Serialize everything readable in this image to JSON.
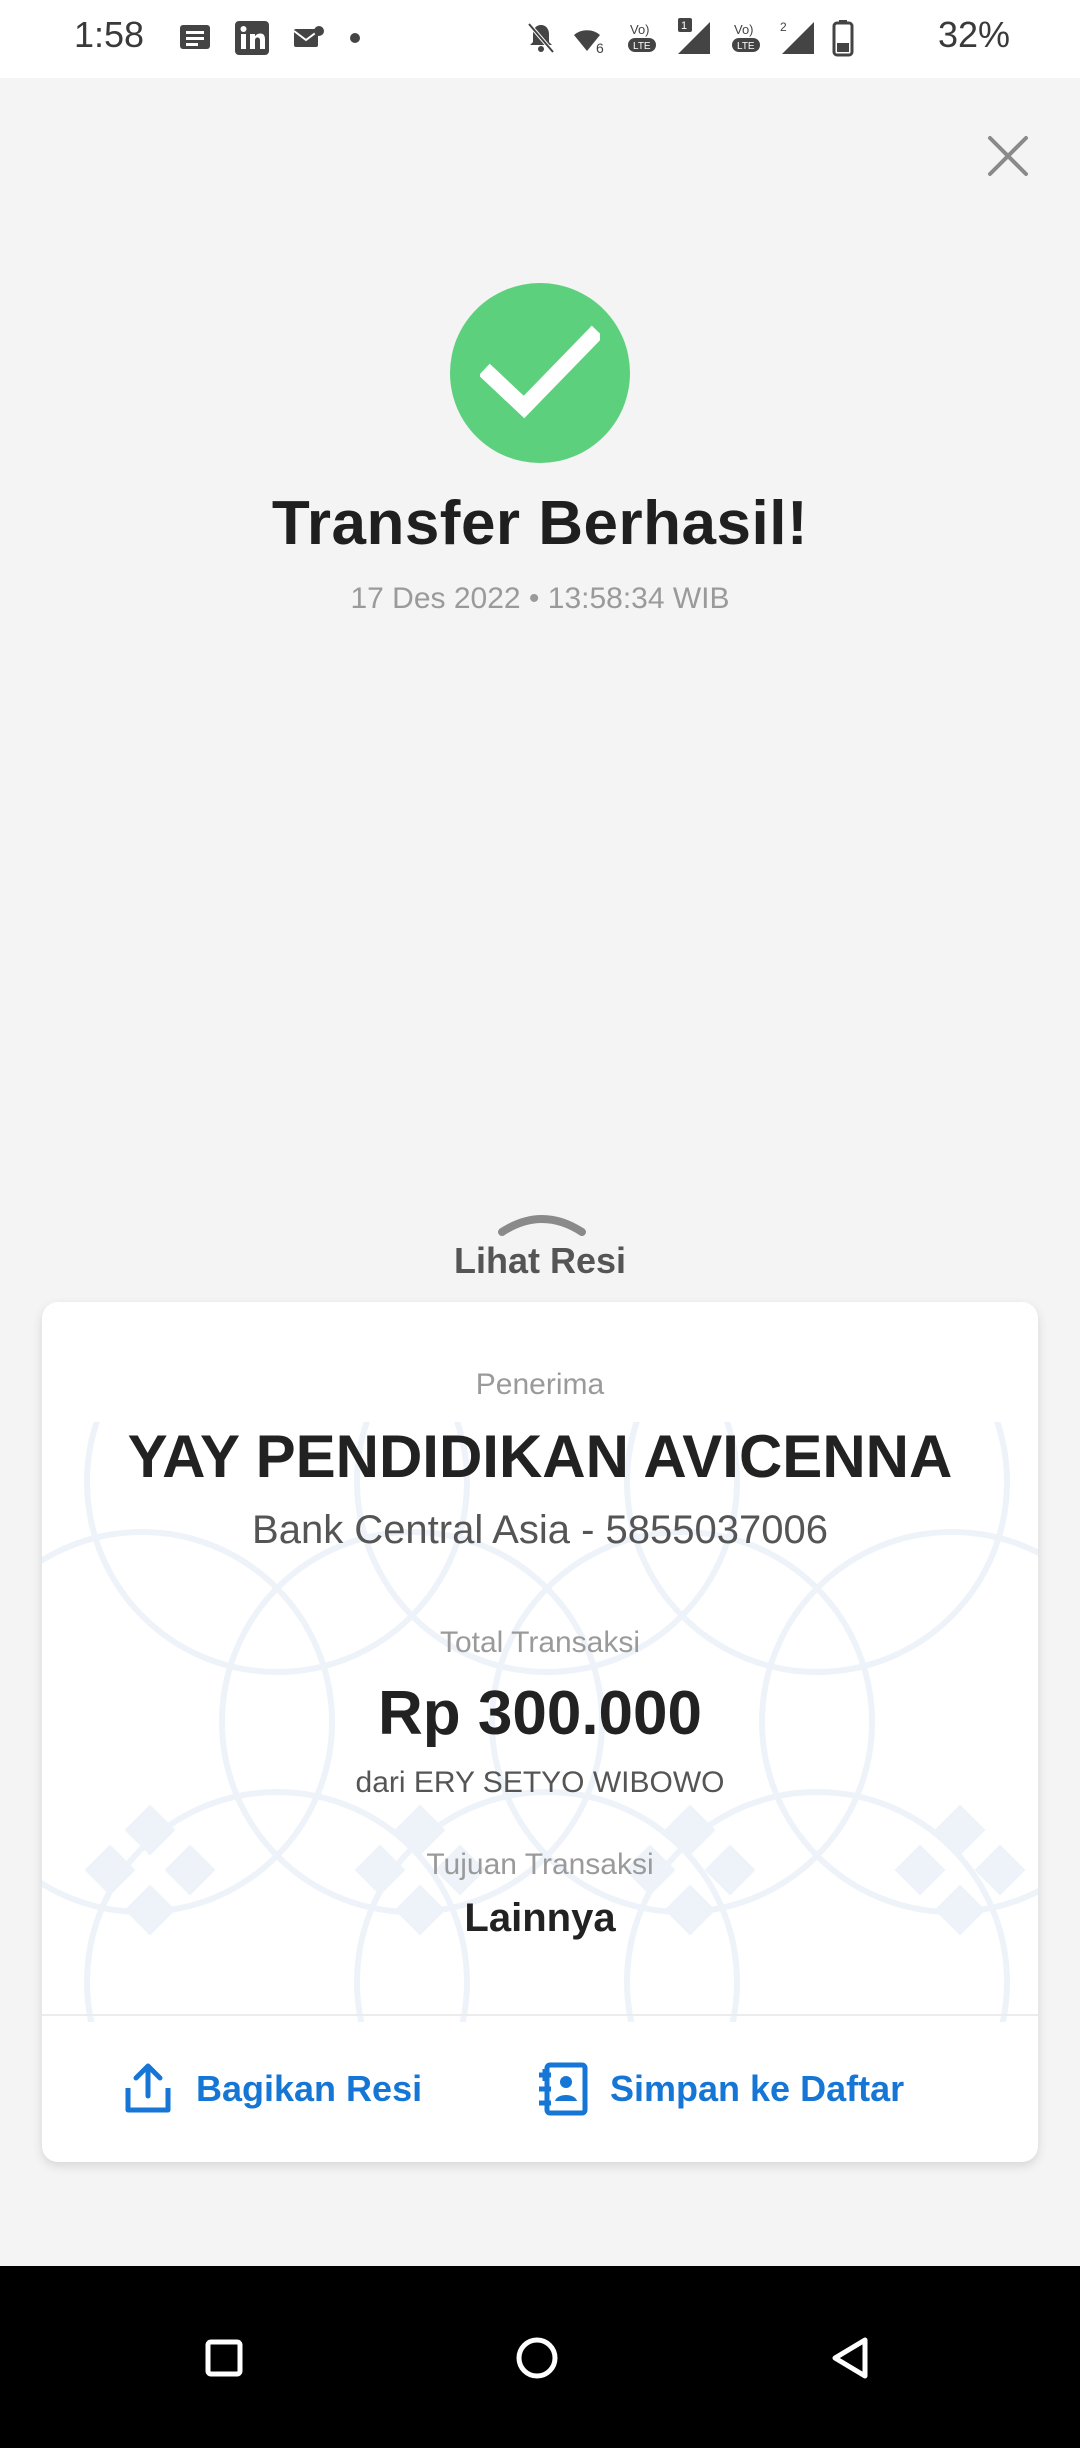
{
  "status_bar": {
    "time": "1:58",
    "battery_percent": "32%",
    "signal_badge_1": "1",
    "signal_badge_2": "2"
  },
  "header": {
    "title": "Transfer Berhasil!",
    "datetime": "17 Des 2022 • 13:58:34 WIB"
  },
  "receipt_toggle": {
    "label": "Lihat Resi"
  },
  "receipt": {
    "recipient_label": "Penerima",
    "recipient_name": "YAY PENDIDIKAN AVICENNA",
    "bank_account": "Bank Central Asia - 5855037006",
    "total_label": "Total Transaksi",
    "total_amount": "Rp 300.000",
    "sender": "dari ERY SETYO WIBOWO",
    "purpose_label": "Tujuan Transaksi",
    "purpose_value": "Lainnya"
  },
  "actions": {
    "share_label": "Bagikan Resi",
    "save_label": "Simpan ke Daftar"
  },
  "icons": {
    "success": "check-circle-icon",
    "close": "close-icon",
    "share": "share-icon",
    "save": "contact-add-icon"
  },
  "colors": {
    "success_green": "#5dd07e",
    "accent_blue": "#1576d6"
  }
}
